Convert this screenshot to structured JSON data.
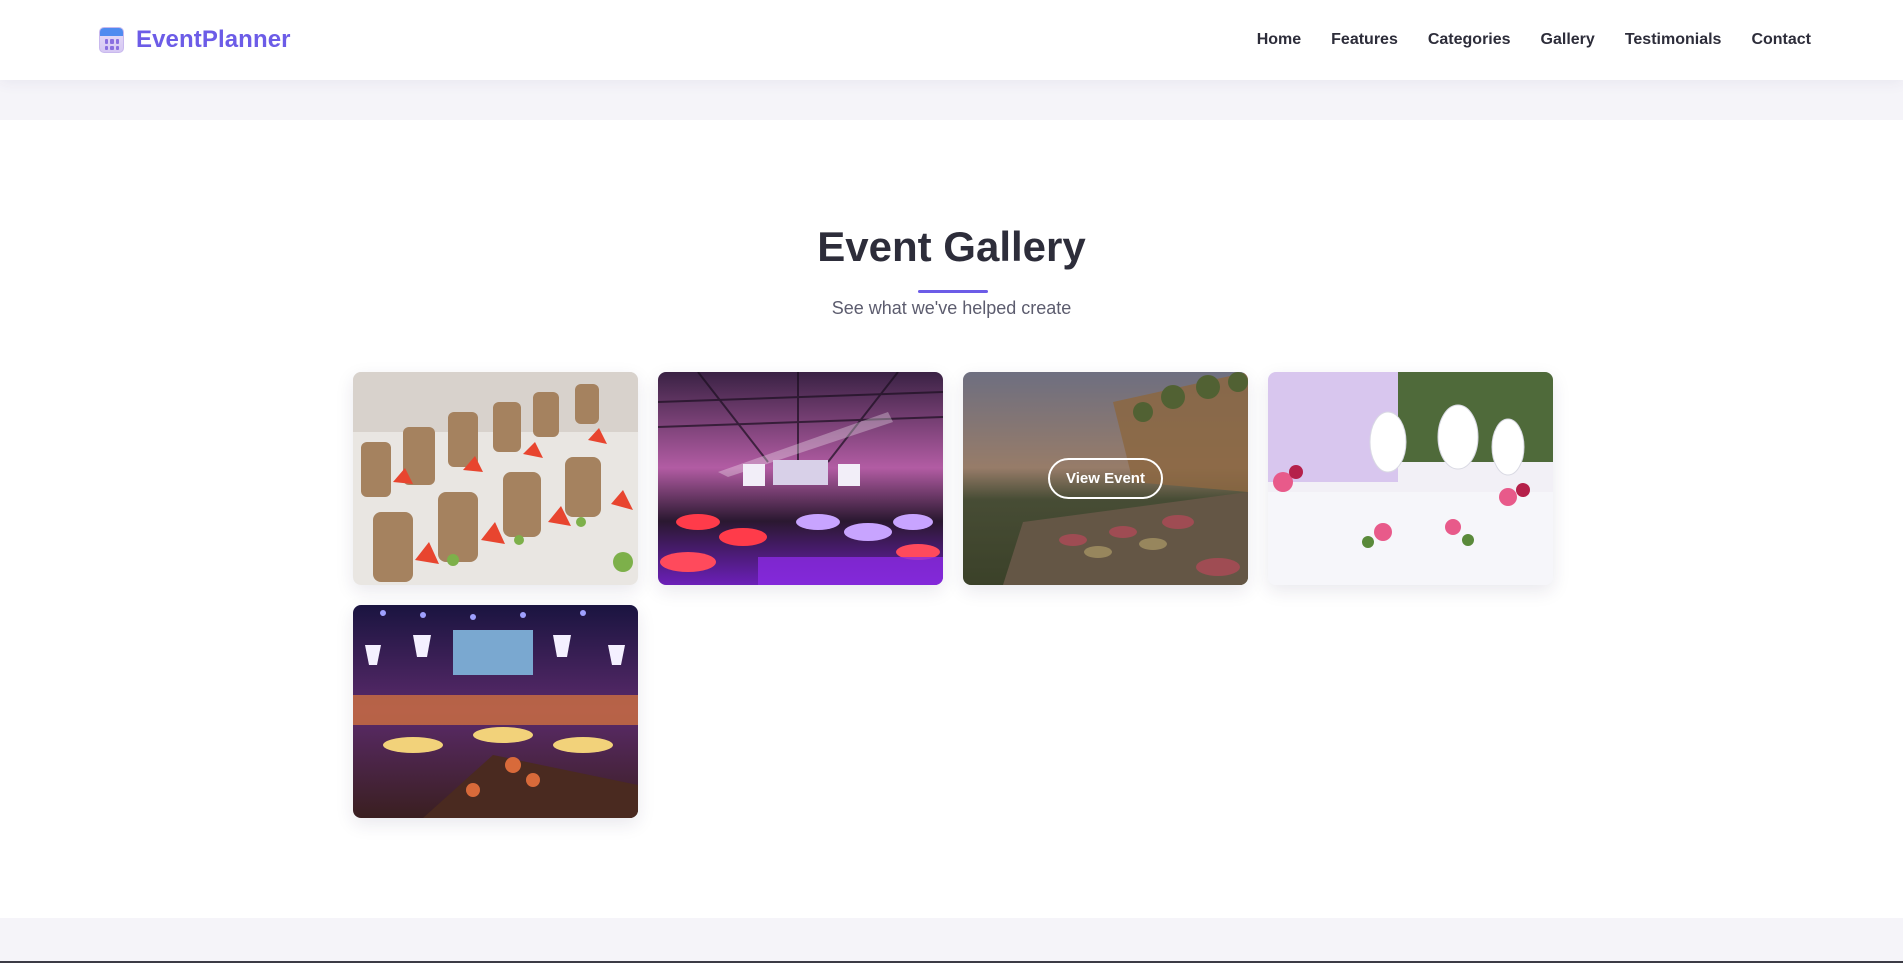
{
  "brand": {
    "name": "EventPlanner",
    "icon": "calendar-icon"
  },
  "nav": {
    "items": [
      "Home",
      "Features",
      "Categories",
      "Gallery",
      "Testimonials",
      "Contact"
    ]
  },
  "gallery": {
    "title": "Event Gallery",
    "subtitle": "See what we've helped create",
    "view_label": "View Event",
    "accent": "#6c5ce7",
    "tiles": [
      {
        "scene": "banquet-chairs-red-napkins"
      },
      {
        "scene": "concert-hall-purple-lighting"
      },
      {
        "scene": "outdoor-buffet-sunset",
        "hover": true
      },
      {
        "scene": "white-table-flowers"
      },
      {
        "scene": "ballroom-chandeliers-purple"
      }
    ]
  }
}
